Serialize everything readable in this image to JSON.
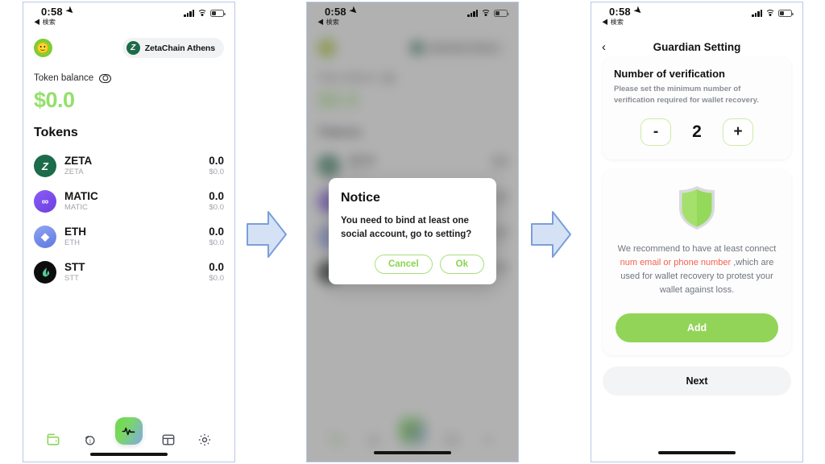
{
  "status_bar": {
    "time": "0:58",
    "back_label": "◀ 検索",
    "location_icon": "location-arrow-icon",
    "signal_icon": "cellular-bars-icon",
    "wifi_icon": "wifi-icon",
    "battery_icon": "battery-low-icon"
  },
  "wallet": {
    "avatar_emoji": "🙂",
    "network_chip": {
      "logo": "Z",
      "label": "ZetaChain Athens"
    },
    "balance_label": "Token balance",
    "eye_icon": "eye-icon",
    "balance_amount": "$0.0",
    "tokens_heading": "Tokens",
    "tokens": [
      {
        "symbol": "ZETA",
        "name": "ZETA",
        "amount": "0.0",
        "fiat": "$0.0",
        "icon": "zeta-token-icon",
        "glyph": "Z"
      },
      {
        "symbol": "MATIC",
        "name": "MATIC",
        "amount": "0.0",
        "fiat": "$0.0",
        "icon": "matic-token-icon",
        "glyph": "∞"
      },
      {
        "symbol": "ETH",
        "name": "ETH",
        "amount": "0.0",
        "fiat": "$0.0",
        "icon": "eth-token-icon",
        "glyph": "◆"
      },
      {
        "symbol": "STT",
        "name": "STT",
        "amount": "0.0",
        "fiat": "$0.0",
        "icon": "stt-token-icon",
        "glyph": "≋"
      }
    ],
    "tabs": [
      {
        "name": "wallet-tab",
        "icon": "wallet-icon",
        "active": true
      },
      {
        "name": "coins-tab",
        "icon": "coins-icon",
        "active": false
      },
      {
        "name": "activity-tab",
        "icon": "activity-pulse-icon",
        "center": true
      },
      {
        "name": "apps-tab",
        "icon": "layout-grid-icon",
        "active": false
      },
      {
        "name": "settings-tab",
        "icon": "gear-icon",
        "active": false
      }
    ]
  },
  "modal": {
    "title": "Notice",
    "message": "You need to bind at least one social account, go to setting?",
    "cancel_label": "Cancel",
    "ok_label": "Ok"
  },
  "guardian": {
    "nav_title": "Guardian Setting",
    "back_icon": "chevron-left-icon",
    "verification": {
      "title": "Number of verification",
      "subtitle": "Please set the minimum number of verification required for wallet recovery.",
      "minus_label": "-",
      "value": "2",
      "plus_label": "+"
    },
    "recommendation": {
      "shield_icon": "shield-icon",
      "text_part1": "We recommend to have at least connect ",
      "highlight": "num email or phone number",
      "text_part2": " ,which are used for wallet recovery to protest your wallet against loss."
    },
    "add_label": "Add",
    "next_label": "Next"
  },
  "flow": {
    "arrow1_icon": "right-arrow-icon",
    "arrow2_icon": "right-arrow-icon"
  },
  "colors": {
    "accent_green": "#92d457",
    "balance_green": "#93e06a",
    "highlight_red": "#f4604f",
    "zeta_dark_green": "#1c6b4a",
    "arrow_fill": "#d5e2f5",
    "arrow_stroke": "#7a9fd8"
  }
}
